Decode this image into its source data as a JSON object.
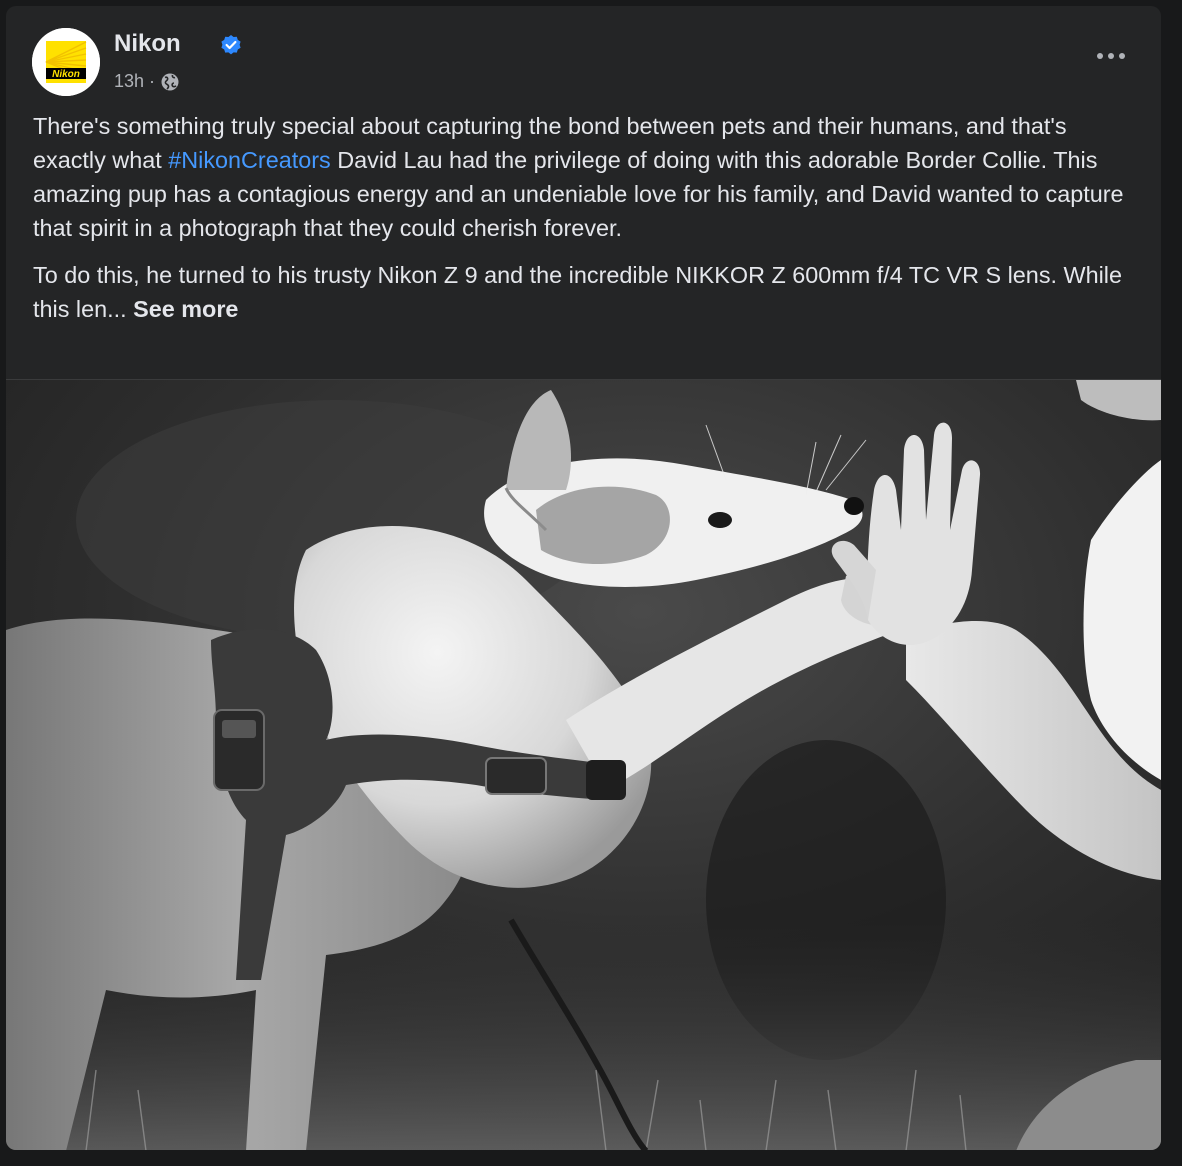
{
  "post": {
    "page_name": "Nikon",
    "avatar_logo_text": "Nikon",
    "verified": true,
    "timestamp": "13h",
    "separator": "·",
    "audience_icon": "globe-icon",
    "more_icon": "more-horizontal-icon",
    "paragraph1_before": "There's something truly special about capturing the bond between pets and their humans, and that's exactly what ",
    "hashtag": "#NikonCreators",
    "paragraph1_after": " David Lau had the privilege of doing with this adorable Border Collie. This amazing pup has a contagious energy and an undeniable love for his family, and David wanted to capture that spirit in a photograph that they could cherish forever.",
    "paragraph2": "To do this, he turned to his trusty Nikon Z 9 and the incredible NIKKOR Z 600mm f/4 TC VR S lens. While this len... ",
    "see_more": "See more",
    "photo_alt": "Black and white photo of a Border Collie giving a high-five to a person's hand"
  },
  "colors": {
    "background": "#18191a",
    "card": "#242526",
    "text_primary": "#e4e6eb",
    "text_secondary": "#b0b3b8",
    "link": "#4599ff",
    "verified_badge": "#2d88ff",
    "nikon_yellow": "#ffe100"
  }
}
